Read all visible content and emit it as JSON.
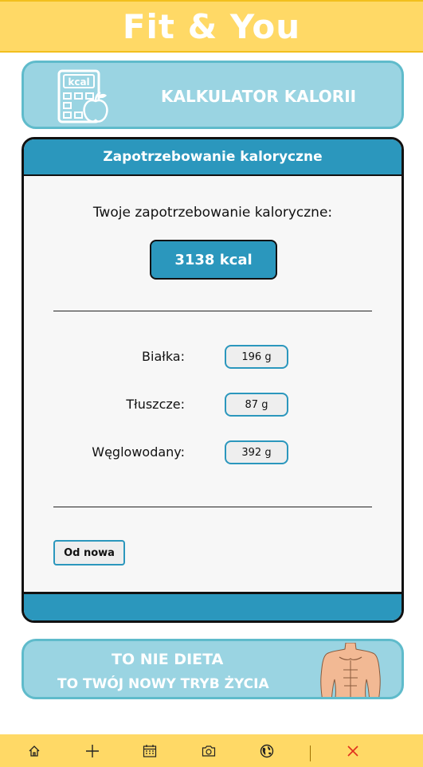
{
  "header": {
    "title": "Fit & You"
  },
  "banner": {
    "title": "KALKULATOR KALORII",
    "icon_text": "kcal"
  },
  "card": {
    "title": "Zapotrzebowanie kaloryczne",
    "need_label": "Twoje zapotrzebowanie kaloryczne:",
    "kcal_value": "3138 kcal",
    "macros": [
      {
        "label": "Białka:",
        "value": "196 g"
      },
      {
        "label": "Tłuszcze:",
        "value": "87 g"
      },
      {
        "label": "Węglowodany:",
        "value": "392 g"
      }
    ],
    "reset_label": "Od nowa"
  },
  "promo": {
    "line1": "TO NIE DIETA",
    "line2": "TO TWÓJ NOWY TRYB ŻYCIA"
  },
  "nav": {
    "icons": [
      "home-icon",
      "plus-icon",
      "calendar-icon",
      "camera-icon",
      "globe-icon",
      "close-icon"
    ]
  },
  "colors": {
    "accent": "#2b97bd",
    "header_bg": "#ffd966",
    "banner_bg": "#9ad4e2",
    "close": "#e0301e"
  }
}
